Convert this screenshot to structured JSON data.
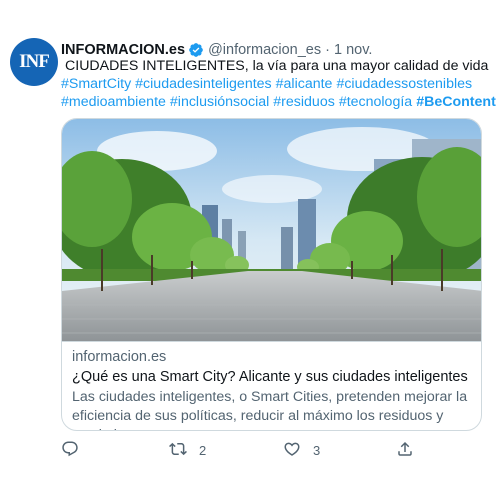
{
  "author": {
    "avatar_text": "INF",
    "display_name": "INFORMACION.es",
    "handle": "@informacion_es",
    "separator": "·",
    "date": "1 nov."
  },
  "tweet": {
    "text_line1": "CIUDADES INTELIGENTES, la vía para una mayor calidad de vida",
    "hashtags_line2": [
      "#SmartCity",
      "#ciudadesinteligentes",
      "#alicante",
      "#ciudadessostenibles"
    ],
    "hashtags_line3": [
      "#medioambiente",
      "#inclusiónsocial",
      "#residuos",
      "#tecnología",
      "#BeContent"
    ]
  },
  "card": {
    "domain": "informacion.es",
    "title": "¿Qué es una Smart City? Alicante y sus ciudades inteligentes",
    "description": "Las ciudades inteligentes, o Smart Cities, pretenden mejorar la eficiencia de sus políticas, reducir al máximo los residuos y maximizar ..."
  },
  "actions": {
    "reply_count": "",
    "retweet_count": "2",
    "like_count": "3"
  },
  "icons": [
    "verified-badge-icon",
    "city-emoji-icon",
    "reply-icon",
    "retweet-icon",
    "like-icon",
    "share-icon"
  ],
  "colors": {
    "link": "#1d9bf0",
    "muted": "#536471",
    "text": "#0f1419",
    "avatar_bg": "#1565b5"
  }
}
